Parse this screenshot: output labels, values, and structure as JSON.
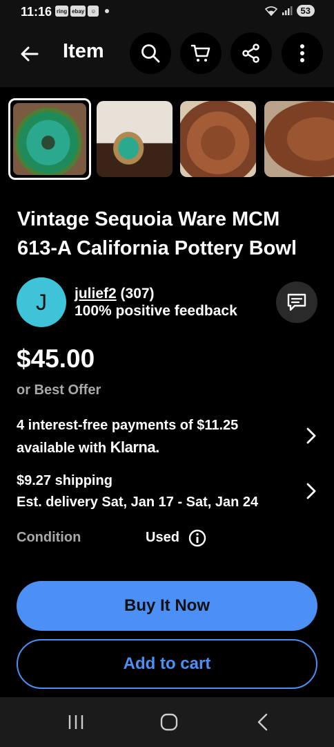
{
  "status_bar": {
    "time": "11:16",
    "notification_icons": [
      "ring",
      "ebay",
      "☺"
    ],
    "battery": "53"
  },
  "app_bar": {
    "title": "Item",
    "icons": [
      "back-arrow-icon",
      "search-icon",
      "cart-icon",
      "share-icon",
      "more-vert-icon"
    ]
  },
  "gallery": {
    "thumbnails": [
      {
        "name": "thumbnail-1",
        "selected": true
      },
      {
        "name": "thumbnail-2",
        "selected": false
      },
      {
        "name": "thumbnail-3",
        "selected": false
      },
      {
        "name": "thumbnail-4",
        "selected": false
      }
    ]
  },
  "listing": {
    "title": "Vintage Sequoia Ware MCM 613-A California Pottery Bowl",
    "price": "$45.00",
    "offer_text": "or Best Offer"
  },
  "seller": {
    "avatar_initial": "J",
    "avatar_color": "#3ec3d8",
    "username": "julief2",
    "feedback_count": "(307)",
    "feedback_percent": "100% positive feedback"
  },
  "payments": {
    "line1": "4 interest-free payments of $11.25",
    "line2_prefix": "available with",
    "provider": "Klarna."
  },
  "shipping": {
    "cost": "$9.27 shipping",
    "delivery": "Est. delivery Sat, Jan 17 - Sat, Jan 24"
  },
  "condition": {
    "label": "Condition",
    "value": "Used"
  },
  "actions": {
    "buy_now": "Buy It Now",
    "add_to_cart": "Add to cart",
    "accent_color": "#4c90f5"
  },
  "system_nav": {
    "icons": [
      "recents-icon",
      "home-icon",
      "back-icon"
    ]
  }
}
